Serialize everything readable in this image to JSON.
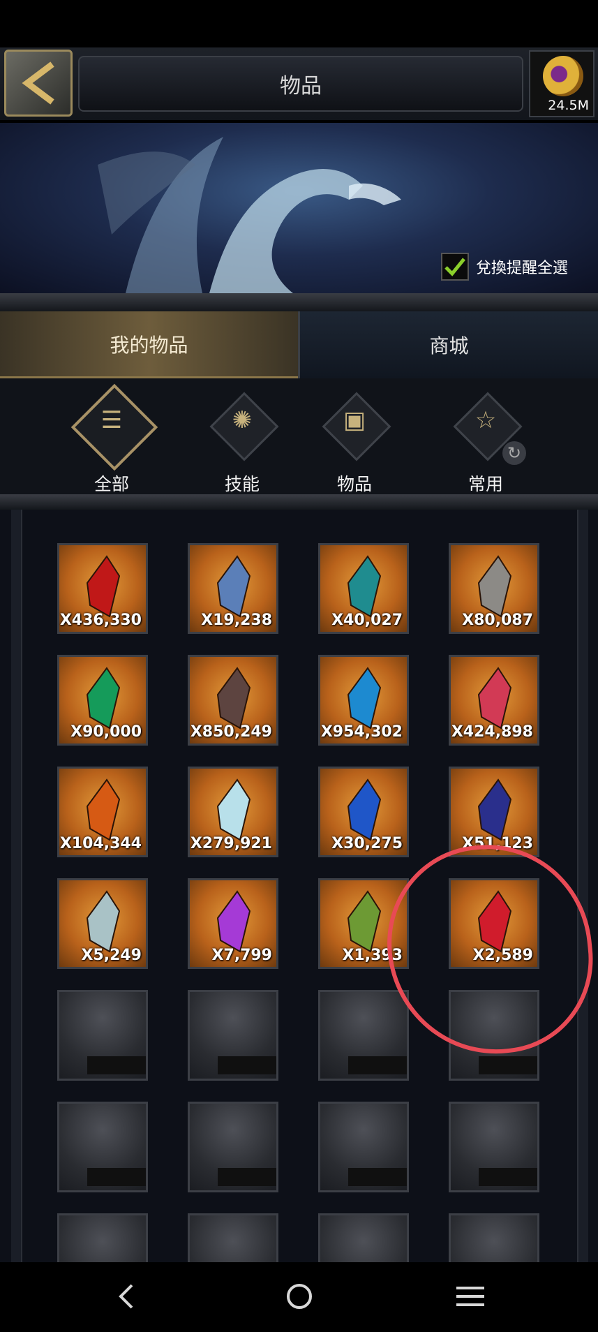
{
  "header": {
    "title": "物品",
    "currency_amount": "24.5M",
    "back_icon": "back-arrow-icon",
    "currency_icon": "gold-coin-icon"
  },
  "banner": {
    "exchange_reminder_label": "兌換提醒全選",
    "exchange_reminder_checked": true
  },
  "tabs": [
    {
      "label": "我的物品",
      "active": true
    },
    {
      "label": "商城",
      "active": false
    }
  ],
  "categories": [
    {
      "label": "全部",
      "icon": "list-icon",
      "active": true
    },
    {
      "label": "技能",
      "icon": "skill-icon",
      "active": false
    },
    {
      "label": "物品",
      "icon": "chest-icon",
      "active": false
    },
    {
      "label": "常用",
      "icon": "star-icon",
      "active": false
    }
  ],
  "items": [
    {
      "qty": "X436,330",
      "color": "#c01818"
    },
    {
      "qty": "X19,238",
      "color": "#5b7fb8"
    },
    {
      "qty": "X40,027",
      "color": "#1f8c8f"
    },
    {
      "qty": "X80,087",
      "color": "#8c8a86"
    },
    {
      "qty": "X90,000",
      "color": "#159b5a"
    },
    {
      "qty": "X850,249",
      "color": "#5d4440"
    },
    {
      "qty": "X954,302",
      "color": "#1d8ad0"
    },
    {
      "qty": "X424,898",
      "color": "#d23a55"
    },
    {
      "qty": "X104,344",
      "color": "#d65a14"
    },
    {
      "qty": "X279,921",
      "color": "#b8e0ea"
    },
    {
      "qty": "X30,275",
      "color": "#1f56c8"
    },
    {
      "qty": "X51,123",
      "color": "#2a2f8c"
    },
    {
      "qty": "X5,249",
      "color": "#a9c2c6"
    },
    {
      "qty": "X7,799",
      "color": "#a53ad6"
    },
    {
      "qty": "X1,393",
      "color": "#6d9a34"
    },
    {
      "qty": "X2,589",
      "color": "#d01c2c"
    }
  ],
  "annotation_color": "#e84a55"
}
